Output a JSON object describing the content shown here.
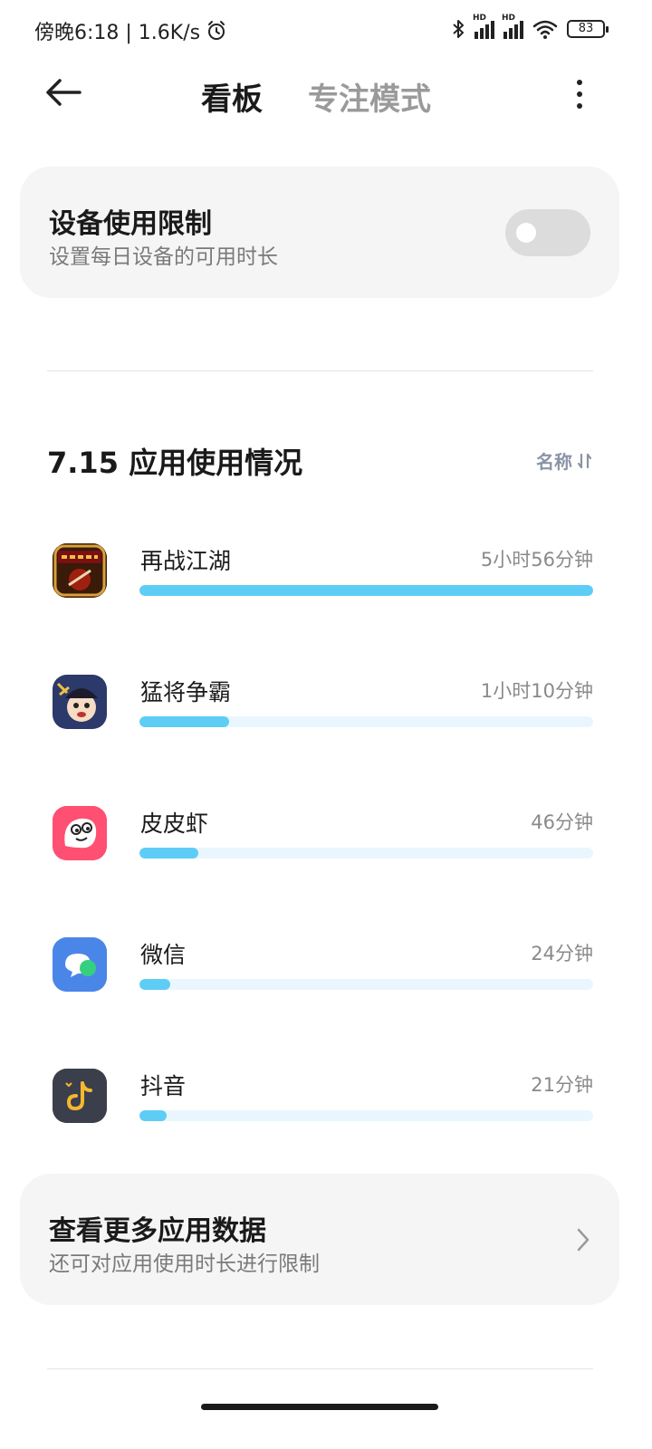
{
  "status_bar": {
    "time_speed": "傍晚6:18 | 1.6K/s",
    "sim1_label": "HD",
    "sim2_label": "HD",
    "battery": "83"
  },
  "header": {
    "tab_active": "看板",
    "tab_inactive": "专注模式"
  },
  "device_limit": {
    "title": "设备使用限制",
    "subtitle": "设置每日设备的可用时长",
    "enabled": false
  },
  "usage": {
    "title": "7.15 应用使用情况",
    "sort_label": "名称",
    "apps": [
      {
        "name": "再战江湖",
        "time": "5小时56分钟",
        "progress": 1.0,
        "icon": "game-jianghu-icon"
      },
      {
        "name": "猛将争霸",
        "time": "1小时10分钟",
        "progress": 0.197,
        "icon": "game-mengjiang-icon"
      },
      {
        "name": "皮皮虾",
        "time": "46分钟",
        "progress": 0.129,
        "icon": "pipixia-icon"
      },
      {
        "name": "微信",
        "time": "24分钟",
        "progress": 0.067,
        "icon": "wechat-icon"
      },
      {
        "name": "抖音",
        "time": "21分钟",
        "progress": 0.059,
        "icon": "douyin-icon"
      }
    ]
  },
  "more_data": {
    "title": "查看更多应用数据",
    "subtitle": "还可对应用使用时长进行限制"
  },
  "colors": {
    "bar_fill": "#5ecdf6",
    "bar_track": "#eaf6fd",
    "card_bg": "#f5f5f5"
  }
}
